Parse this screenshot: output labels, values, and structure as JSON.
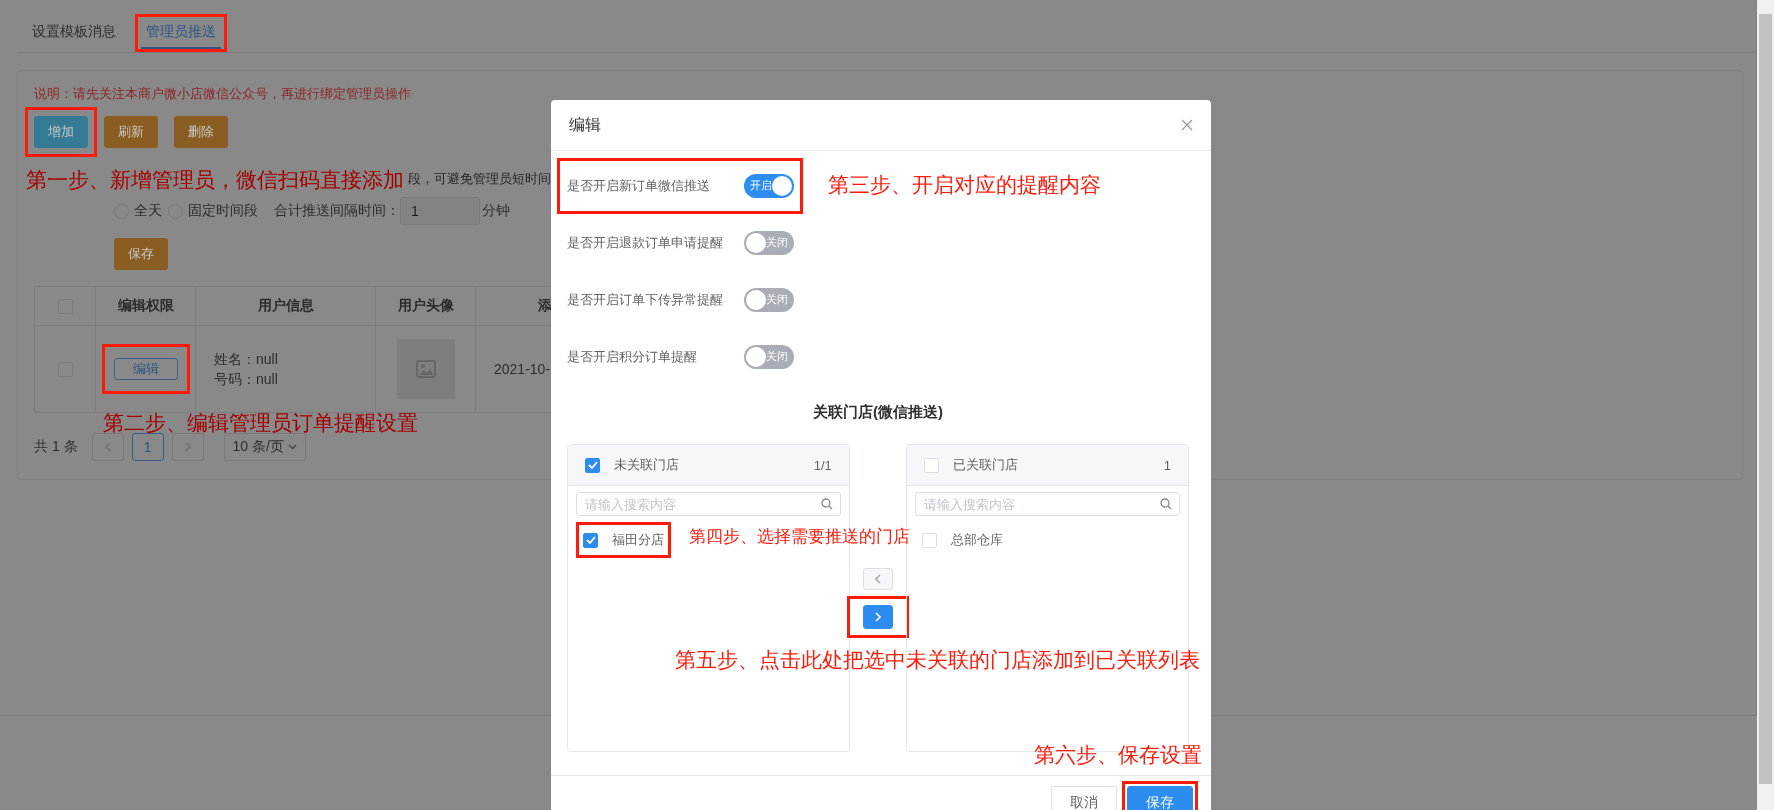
{
  "tabs": [
    {
      "label": "设置模板消息",
      "selected": false,
      "highlighted": false
    },
    {
      "label": "管理员推送",
      "selected": true,
      "highlighted": true
    }
  ],
  "notice": "说明：请先关注本商户微小店微信公众号，再进行绑定管理员操作",
  "toolbar": [
    {
      "label": "增加",
      "kind": "primary",
      "highlighted": true
    },
    {
      "label": "刷新",
      "kind": "warning",
      "highlighted": false
    },
    {
      "label": "删除",
      "kind": "warning",
      "highlighted": false
    }
  ],
  "push_settings": {
    "hint": "段，可避免管理员短时间",
    "radios": [
      {
        "label": "全天",
        "selected": false
      },
      {
        "label": "固定时间段",
        "selected": false
      }
    ],
    "interval_label": "合计推送间隔时间：",
    "interval_value": "1",
    "interval_unit": "分钟",
    "save": "保存"
  },
  "table": {
    "header_checked": false,
    "columns": [
      "编辑权限",
      "用户信息",
      "用户头像",
      "添"
    ],
    "rows": [
      {
        "checked": false,
        "edit": "编辑",
        "edit_highlighted": true,
        "user_info": [
          "姓名：null",
          "号码：null"
        ],
        "added": "2021-10-"
      }
    ]
  },
  "pagination": {
    "total": "共 1 条",
    "pages": [
      {
        "label": "1",
        "selected": true
      }
    ],
    "page_size": "10 条/页"
  },
  "modal": {
    "title": "编辑",
    "switches": [
      {
        "label": "是否开启新订单微信推送",
        "on": true,
        "text": "开启",
        "highlighted": true
      },
      {
        "label": "是否开启退款订单申请提醒",
        "on": false,
        "text": "关闭",
        "highlighted": false
      },
      {
        "label": "是否开启订单下传异常提醒",
        "on": false,
        "text": "关闭",
        "highlighted": false
      },
      {
        "label": "是否开启积分订单提醒",
        "on": false,
        "text": "关闭",
        "highlighted": false
      }
    ],
    "section_title": "关联门店(微信推送)",
    "transfer": {
      "panels": [
        {
          "title": "未关联门店",
          "checked": true,
          "count": "1/1",
          "placeholder": "请输入搜索内容",
          "items": [
            {
              "label": "福田分店",
              "checked": true,
              "highlighted": true
            }
          ]
        },
        {
          "title": "已关联门店",
          "checked": false,
          "count": "1",
          "placeholder": "请输入搜索内容",
          "items": [
            {
              "label": "总部仓库",
              "checked": false,
              "highlighted": false
            }
          ]
        }
      ],
      "buttons": [
        {
          "kind": "left",
          "enabled": false,
          "highlighted": false
        },
        {
          "kind": "right",
          "enabled": true,
          "highlighted": true
        }
      ]
    },
    "footer": [
      {
        "label": "取消",
        "kind": "default",
        "highlighted": false
      },
      {
        "label": "保存",
        "kind": "primary",
        "highlighted": true
      }
    ]
  },
  "annotations": [
    "第一步、新增管理员，微信扫码直接添加",
    "第二步、编辑管理员订单提醒设置",
    "第三步、开启对应的提醒内容",
    "第四步、选择需要推送的门店",
    "第五步、点击此处把选中未关联的门店添加到已关联列表",
    "第六步、保存设置"
  ]
}
